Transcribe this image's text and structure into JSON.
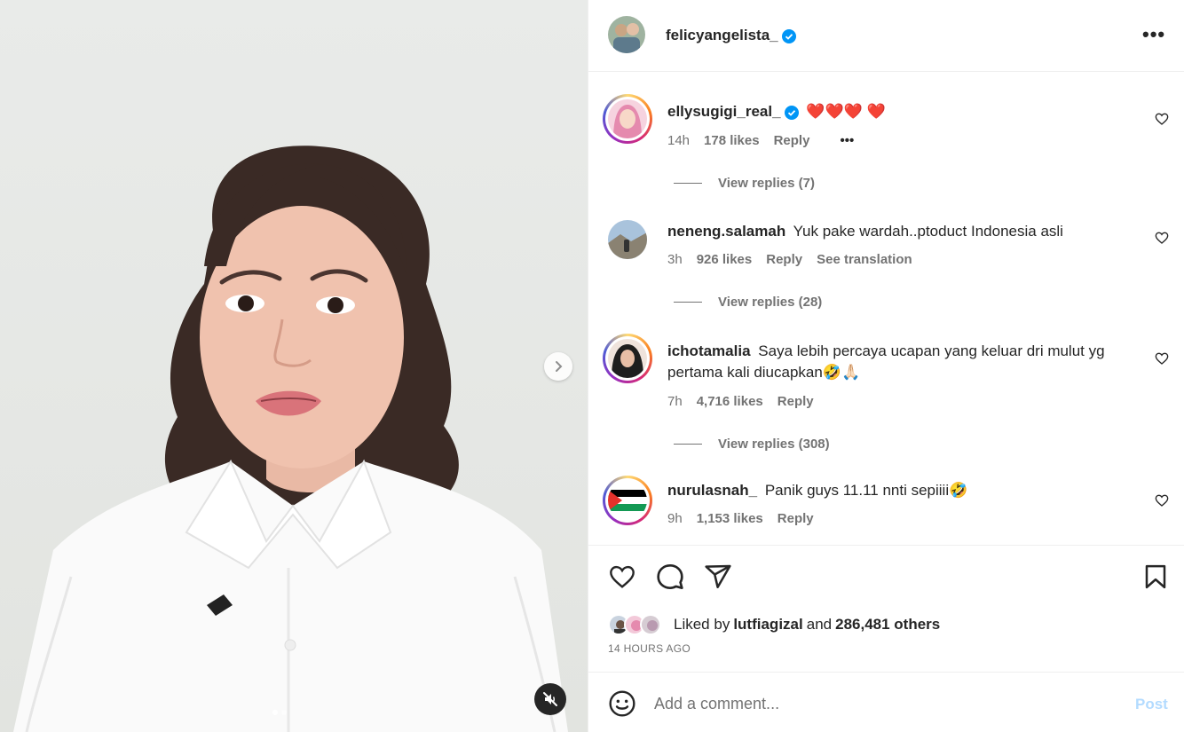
{
  "post": {
    "author": "felicyangelista_",
    "verified": true,
    "more_label": "•••"
  },
  "media": {
    "next_icon": "chevron-right-icon",
    "mute_icon": "speaker-muted-icon",
    "slide_count": 2,
    "active_slide": 0
  },
  "comments": [
    {
      "username": "ellysugigi_real_",
      "verified": true,
      "text": "❤️❤️❤️ ❤️",
      "time": "14h",
      "likes": "178 likes",
      "reply": "Reply",
      "extra": "•••",
      "view_replies": "View replies (7)"
    },
    {
      "username": "neneng.salamah",
      "verified": false,
      "text": "Yuk pake wardah..ptoduct Indonesia asli",
      "time": "3h",
      "likes": "926 likes",
      "reply": "Reply",
      "extra": "See translation",
      "view_replies": "View replies (28)"
    },
    {
      "username": "ichotamalia",
      "verified": false,
      "text": "Saya lebih percaya ucapan yang keluar dri mulut yg pertama kali diucapkan🤣🙏🏻",
      "time": "7h",
      "likes": "4,716 likes",
      "reply": "Reply",
      "view_replies": "View replies (308)"
    },
    {
      "username": "nurulasnah_",
      "verified": false,
      "text": "Panik guys 11.11 nnti sepiiii🤣",
      "time": "9h",
      "likes": "1,153 likes",
      "reply": "Reply"
    }
  ],
  "actions": {
    "like_icon": "heart-icon",
    "comment_icon": "comment-bubble-icon",
    "share_icon": "paper-plane-icon",
    "save_icon": "bookmark-icon"
  },
  "likes": {
    "prefix": "Liked by",
    "user": "lutfiagizal",
    "joiner": "and",
    "others": "286,481 others"
  },
  "time_ago": "14 HOURS AGO",
  "comment_box": {
    "placeholder": "Add a comment...",
    "post_label": "Post"
  },
  "colors": {
    "verified": "#0095f6",
    "text": "#262626",
    "secondary": "#737373",
    "post_disabled": "#b3dbff"
  }
}
